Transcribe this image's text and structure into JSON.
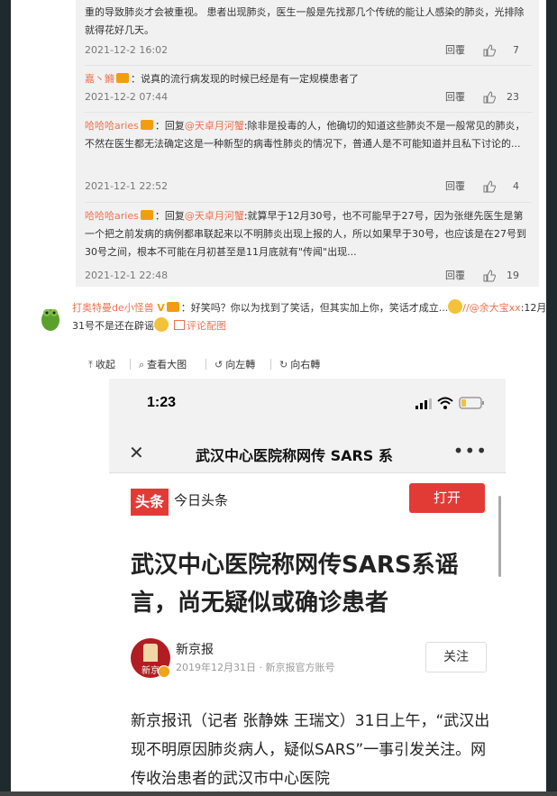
{
  "replies": [
    {
      "text": "重的导致肺炎才会被重视。 患者出现肺炎，医生一般是先找那几个传统的能让人感染的肺炎，光排除就得花好几天。",
      "time": "2021-12-2 16:02",
      "reply_label": "回覆",
      "likes": "7"
    },
    {
      "user": "嘉丶鏅",
      "body": "：说真的流行病发现的时候已经是有一定规模患者了",
      "time": "2021-12-2 07:44",
      "reply_label": "回覆",
      "likes": "23"
    },
    {
      "user": "哈哈哈aries",
      "prefix": "：回复",
      "at": "@天卓月河蟹",
      "body": ":除非是投毒的人，他确切的知道这些肺炎不是一般常见的肺炎，不然在医生都无法确定这是一种新型的病毒性肺炎的情况下，普通人是不可能知道并且私下讨论的...",
      "time": "2021-12-1 22:52",
      "reply_label": "回覆",
      "likes": "4"
    },
    {
      "user": "哈哈哈aries",
      "prefix": "：回复",
      "at": "@天卓月河蟹",
      "body": ":就算早于12月30号，也不可能早于27号，因为张继先医生是第一个把之前发病的病例都串联起来以不明肺炎出现上报的人，所以如果早于30号，也应该是在27号到30号之间，根本不可能在月初甚至是11月底就有\"传闻\"出现...",
      "time": "2021-12-1 22:48",
      "reply_label": "回覆",
      "likes": "19"
    }
  ],
  "comment": {
    "user": "打奥特曼de小怪兽",
    "vmark": "V",
    "text_a": "：好笑吗？你以为找到了笑话，但其实加上你，笑话才成立...",
    "at": "//@余大宝xx",
    "text_b": ":12月31号不是还在辟谣",
    "pic_label": "评论配图"
  },
  "toolbar": {
    "collapse": "收起",
    "view_large": "查看大图",
    "rotate_left": "向左轉",
    "rotate_right": "向右轉"
  },
  "phone": {
    "time": "1:23",
    "nav_title": "武汉中心医院称网传 SARS 系",
    "app_logo": "头条",
    "app_name": "今日头条",
    "open_button": "打开",
    "headline": "武汉中心医院称网传SARS系谣言，尚无疑似或确诊患者",
    "source_logo_text": "新京",
    "source_name": "新京报",
    "source_meta": "2019年12月31日 · 新京报官方账号",
    "follow_button": "关注",
    "body": "新京报讯（记者 张静姝 王瑞文）31日上午，“武汉出现不明原因肺炎病人，疑似SARS”一事引发关注。网传收治患者的武汉市中心医院"
  },
  "icons": {
    "thumb": "thumbs-up-icon",
    "collapse": "arrow-up-icon",
    "view": "search-icon",
    "rotate_left": "rotate-left-icon",
    "rotate_right": "rotate-right-icon",
    "close": "close-icon",
    "more": "more-icon",
    "signal": "signal-icon",
    "wifi": "wifi-icon",
    "battery": "battery-icon"
  },
  "colors": {
    "link": "#eb7350",
    "brand_red": "#e23b36",
    "reply_bg": "#f1f1f1"
  }
}
